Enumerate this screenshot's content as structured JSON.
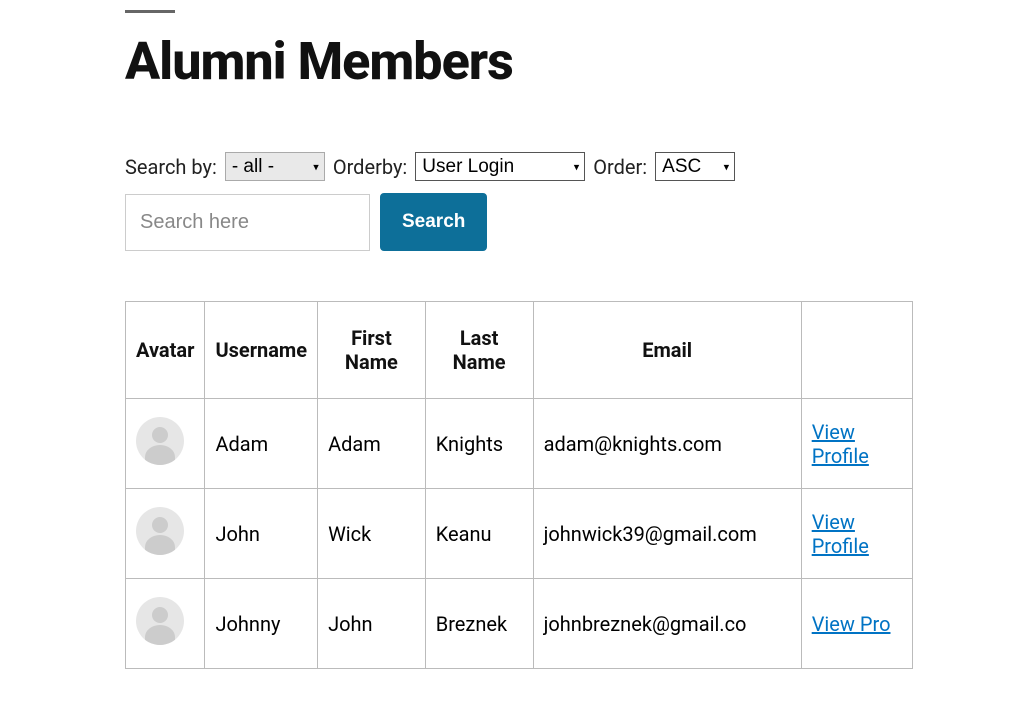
{
  "page_title": "Alumni Members",
  "filters": {
    "search_by_label": "Search by:",
    "search_by_value": "- all -",
    "orderby_label": "Orderby:",
    "orderby_value": "User Login",
    "order_label": "Order:",
    "order_value": "ASC",
    "search_placeholder": "Search here",
    "search_button": "Search"
  },
  "table": {
    "headers": {
      "avatar": "Avatar",
      "username": "Username",
      "first_name": "First Name",
      "last_name": "Last Name",
      "email": "Email",
      "action": ""
    },
    "rows": [
      {
        "username": "Adam",
        "first_name": "Adam",
        "last_name": "Knights",
        "email": "adam@knights.com",
        "action": "View Profile"
      },
      {
        "username": "John",
        "first_name": "Wick",
        "last_name": "Keanu",
        "email": "johnwick39@gmail.com",
        "action": "View Profile"
      },
      {
        "username": "Johnny",
        "first_name": "John",
        "last_name": "Breznek",
        "email": "johnbreznek@gmail.co",
        "action": "View Pro"
      }
    ]
  }
}
